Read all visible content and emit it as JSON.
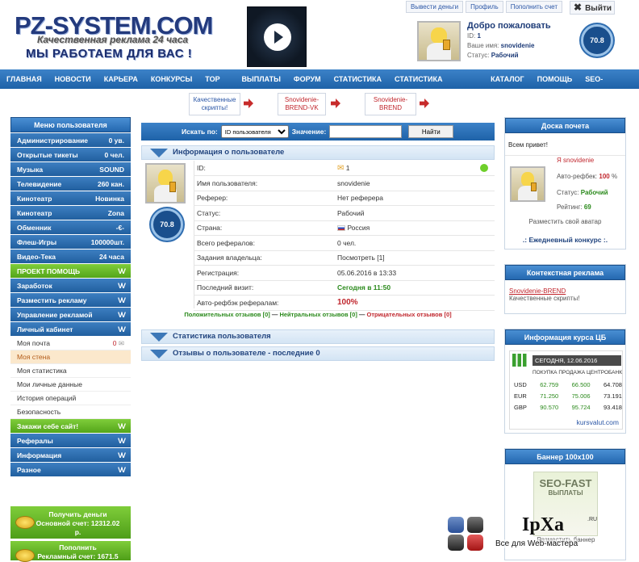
{
  "header": {
    "logo": "PZ-SYSTEM.COM",
    "tagline1": "Качественная реклама 24 часа",
    "tagline2": "МЫ РАБОТАЕМ ДЛЯ ВАС !",
    "top_links": [
      "Вывести деньги",
      "Профиль",
      "Пополнить счет"
    ],
    "logout": "Выйти",
    "welcome": "Добро пожаловать",
    "id_label": "ID:",
    "id_value": "1",
    "name_label": "Ваше имя:",
    "name_value": "snovidenie",
    "status_label": "Статус:",
    "status_value": "Рабочий",
    "rating": "70.8"
  },
  "nav": [
    "ГЛАВНАЯ",
    "НОВОСТИ",
    "КАРЬЕРА",
    "КОНКУРСЫ",
    "TOP 30",
    "ВЫПЛАТЫ",
    "ФОРУМ",
    "СТАТИСТИКА",
    "СТАТИСТИКА РЕКЛАМЫ",
    "КАТАЛОГ",
    "ПОМОЩЬ",
    "SEO-FAST"
  ],
  "ads": [
    {
      "line1": "Качественные",
      "line2": "скрипты!",
      "color": "#2a56a6"
    },
    {
      "line1": "Snovidenie-",
      "line2": "BREND-VK",
      "color": "#c0262d"
    },
    {
      "line1": "Snovidenie-",
      "line2": "BREND",
      "color": "#c0262d"
    }
  ],
  "left_menu": {
    "title": "Меню пользователя",
    "items": [
      {
        "label": "Администрирование",
        "value": "0 ув.",
        "type": "blue"
      },
      {
        "label": "Открытые тикеты",
        "value": "0 чел.",
        "type": "blue"
      },
      {
        "label": "Музыка",
        "value": "SOUND",
        "type": "blue"
      },
      {
        "label": "Телевидение",
        "value": "260 кан.",
        "type": "blue"
      },
      {
        "label": "Кинотеатр",
        "value": "Новинка",
        "type": "blue"
      },
      {
        "label": "Кинотеатр",
        "value": "Zona",
        "type": "blue"
      },
      {
        "label": "Обменник",
        "value": "-€-",
        "type": "blue"
      },
      {
        "label": "Флеш-Игры",
        "value": "100000шт.",
        "type": "blue"
      },
      {
        "label": "Видео-Тека",
        "value": "24 часа",
        "type": "blue"
      },
      {
        "label": "ПРОЕКТ ПОМОЩЬ",
        "value": "VV",
        "type": "green"
      },
      {
        "label": "Заработок",
        "value": "VV",
        "type": "blue"
      },
      {
        "label": "Разместить рекламу",
        "value": "VV",
        "type": "blue"
      },
      {
        "label": "Управление рекламой",
        "value": "VV",
        "type": "blue"
      },
      {
        "label": "Личный кабинет",
        "value": "VV",
        "type": "blue"
      }
    ],
    "sub_items": [
      "Моя почта",
      "Моя стена",
      "Моя статистика",
      "Мои личные данные",
      "История операций",
      "Безопасность"
    ],
    "mail_count": "0",
    "items2": [
      {
        "label": "Закажи себе сайт!",
        "value": "VV",
        "type": "green"
      },
      {
        "label": "Рефералы",
        "value": "VV",
        "type": "blue"
      },
      {
        "label": "Информация",
        "value": "VV",
        "type": "blue"
      },
      {
        "label": "Разное",
        "value": "VV",
        "type": "blue"
      }
    ],
    "withdraw_line1": "Получить деньги",
    "withdraw_line2": "Основной счет: 12312.02",
    "withdraw_line3": "р.",
    "topup_line1": "Пополнить",
    "topup_line2": "Рекламный счет: 1671.5"
  },
  "search": {
    "label": "Искать по:",
    "select": "ID пользователя",
    "value_label": "Значение:",
    "button": "Найти"
  },
  "user_info": {
    "title": "Информация о пользователе",
    "rating": "70.8",
    "rows": [
      {
        "label": "ID:",
        "value": "1"
      },
      {
        "label": "Имя пользователя:",
        "value": "snovidenie"
      },
      {
        "label": "Реферер:",
        "value": "Нет реферера"
      },
      {
        "label": "Статус:",
        "value": "Рабочий"
      },
      {
        "label": "Страна:",
        "value": "Россия"
      },
      {
        "label": "Всего рефералов:",
        "value": "0 чел."
      },
      {
        "label": "Задания владельца:",
        "value": "Посмотреть [1]"
      },
      {
        "label": "Регистрация:",
        "value": "05.06.2016 в 13:33"
      },
      {
        "label": "Последний визит:",
        "value": "Сегодня в 11:50"
      },
      {
        "label": "Авто-рефбэк рефералам:",
        "value": "100%"
      }
    ],
    "reviews_pos": "Положительных отзывов [0]",
    "reviews_neu": "Нейтральных отзывов [0]",
    "reviews_neg": "Отрицательных отзывов [0]",
    "sep": " — "
  },
  "sections": [
    "Статистика пользователя",
    "Отзывы о пользователе - последние 0"
  ],
  "honor": {
    "title": "Доска почета",
    "hello": "Всем привет!",
    "name": "Я snovidenie",
    "refback_label": "Авто-рефбек:",
    "refback_value": "100",
    "pct": "%",
    "status_label": "Статус:",
    "status_value": "Рабочий",
    "rating_label": "Рейтинг:",
    "rating_value": "69",
    "place_avatar": "Разместить свой аватар",
    "contest": ".: Ежедневный конкурс :."
  },
  "context_ad": {
    "title": "Контекстная реклама",
    "link": "Snovidenie-BREND",
    "text": "Качественные скрипты!"
  },
  "cbr": {
    "title": "Информация курса ЦБ",
    "date": "СЕГОДНЯ, 12.06.2016",
    "h1": "ПОКУПКА",
    "h2": "ПРОДАЖА",
    "h3": "ЦЕНТРОБАНК",
    "rows": [
      [
        "USD",
        "62.759",
        "66.500",
        "64.708"
      ],
      [
        "EUR",
        "71.250",
        "75.006",
        "73.191"
      ],
      [
        "GBP",
        "90.570",
        "95.724",
        "93.418"
      ]
    ],
    "source": "kursvalut.com"
  },
  "banner": {
    "title": "Баннер 100x100",
    "logo": "SEO-FAST",
    "sub": "ВЫПЛАТЫ",
    "place": "Разместить баннер"
  },
  "watermark": {
    "brand": "IpXa",
    "ru": ".RU",
    "slogan": "Все для Web-мастера"
  }
}
